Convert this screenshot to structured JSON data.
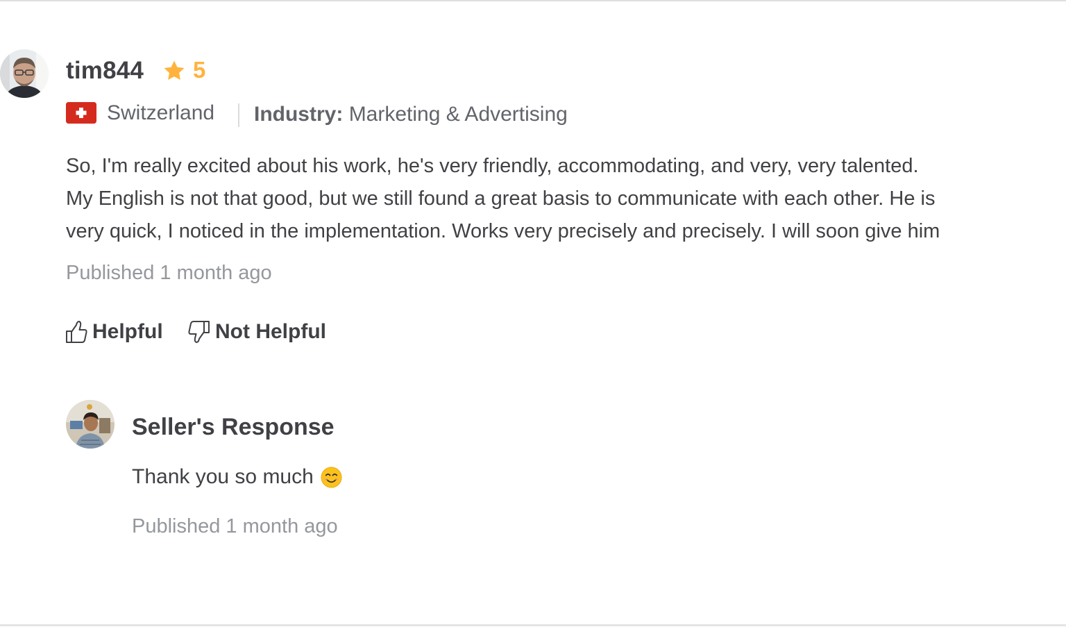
{
  "review": {
    "username": "tim844",
    "rating": "5",
    "country": "Switzerland",
    "industry_label": "Industry:",
    "industry_value": "Marketing & Advertising",
    "text_lines": [
      "So, I'm really excited about his work, he's very friendly, accommodating, and very, very talented.",
      "My English is not that good, but we still found a great basis to communicate with each other. He is",
      "very quick, I noticed in the implementation. Works very precisely and precisely. I will soon give him"
    ],
    "published": "Published 1 month ago",
    "helpful_label": "Helpful",
    "not_helpful_label": "Not Helpful"
  },
  "seller_response": {
    "title": "Seller's Response",
    "text": "Thank you so much",
    "emoji": "smiling-face-icon",
    "published": "Published 1 month ago"
  },
  "colors": {
    "text_primary": "#404145",
    "text_secondary": "#62646a",
    "text_muted": "#95979d",
    "star": "#ffb33e",
    "flag_red": "#d52b1e"
  }
}
